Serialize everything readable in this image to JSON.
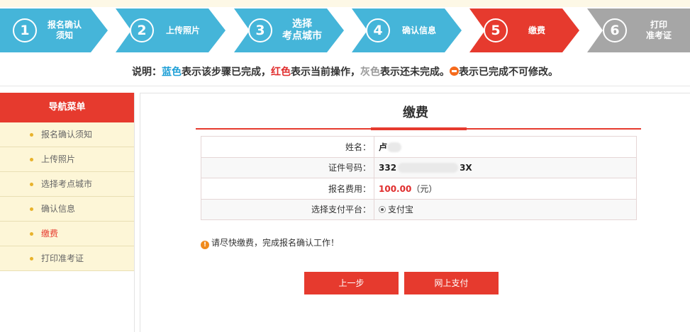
{
  "steps": [
    {
      "num": "1",
      "label_line1": "报名确认",
      "label_line2": "须知",
      "status": "done"
    },
    {
      "num": "2",
      "label_line1": "上传照片",
      "label_line2": "",
      "status": "done"
    },
    {
      "num": "3",
      "label_line1": "选择",
      "label_line2": "考点城市",
      "status": "done"
    },
    {
      "num": "4",
      "label_line1": "确认信息",
      "label_line2": "",
      "status": "done"
    },
    {
      "num": "5",
      "label_line1": "缴费",
      "label_line2": "",
      "status": "current"
    },
    {
      "num": "6",
      "label_line1": "打印",
      "label_line2": "准考证",
      "status": "pending"
    }
  ],
  "legend": {
    "prefix": "说明：",
    "blue_word": "蓝色",
    "blue_desc": "表示该步骤已完成，",
    "red_word": "红色",
    "red_desc": "表示当前操作，",
    "gray_word": "灰色",
    "gray_desc": "表示还未完成。",
    "icon_desc": "表示已完成不可修改。"
  },
  "sidebar": {
    "title": "导航菜单",
    "items": [
      {
        "label": "报名确认须知"
      },
      {
        "label": "上传照片"
      },
      {
        "label": "选择考点城市"
      },
      {
        "label": "确认信息"
      },
      {
        "label": "缴费"
      },
      {
        "label": "打印准考证"
      }
    ]
  },
  "main": {
    "title": "缴费",
    "form": {
      "name_label": "姓名：",
      "name_value": "卢",
      "id_label": "证件号码：",
      "id_prefix": "332",
      "id_suffix": "3X",
      "fee_label": "报名费用：",
      "fee_value": "100.00",
      "fee_unit": "（元）",
      "pay_label": "选择支付平台：",
      "pay_option": "支付宝"
    },
    "notice": "请尽快缴费，完成报名确认工作！",
    "prev_button": "上一步",
    "pay_button": "网上支付"
  },
  "colors": {
    "done": "#45b5d9",
    "current": "#e63a2e",
    "pending": "#a6a6a6"
  }
}
